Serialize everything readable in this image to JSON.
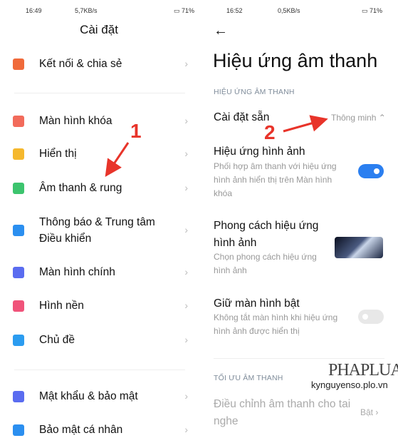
{
  "left": {
    "status": {
      "time": "16:49",
      "speed": "5,7KB/s",
      "battery": "71"
    },
    "title": "Cài đặt",
    "items": [
      {
        "label": "Kết nối & chia sẻ",
        "icon": "connection-icon",
        "color": "#f06a3a"
      },
      {
        "label": "Màn hình khóa",
        "icon": "lock-icon",
        "color": "#f26b5b"
      },
      {
        "label": "Hiển thị",
        "icon": "sun-icon",
        "color": "#f5b82e"
      },
      {
        "label": "Âm thanh & rung",
        "icon": "speaker-icon",
        "color": "#3cc46e"
      },
      {
        "label": "Thông báo & Trung tâm",
        "label2": "Điều khiển",
        "icon": "notification-icon",
        "color": "#2b8ff0"
      },
      {
        "label": "Màn hình chính",
        "icon": "home-icon",
        "color": "#5a6cf0"
      },
      {
        "label": "Hình nền",
        "icon": "flower-icon",
        "color": "#f0537a"
      },
      {
        "label": "Chủ đề",
        "icon": "theme-icon",
        "color": "#2b9cf0"
      },
      {
        "label": "Mật khẩu & bảo mật",
        "icon": "fingerprint-icon",
        "color": "#5a6cf0"
      },
      {
        "label": "Bảo mật cá nhân",
        "icon": "privacy-icon",
        "color": "#2b8ff0"
      }
    ]
  },
  "right": {
    "status": {
      "time": "16:52",
      "speed": "0,5KB/s",
      "battery": "71"
    },
    "title": "Hiệu ứng âm thanh",
    "section1": "HIỆU ỨNG ÂM THANH",
    "preset": {
      "label": "Cài đặt sẵn",
      "value": "Thông minh"
    },
    "visual": {
      "label": "Hiệu ứng hình ảnh",
      "desc1": "Phối hợp âm thanh với hiệu ứng",
      "desc2": "hình ảnh hiển thị trên Màn hình",
      "desc3": "khóa",
      "enabled": true
    },
    "style": {
      "label1": "Phong cách hiệu ứng",
      "label2": "hình ảnh",
      "desc1": "Chọn phong cách hiệu ứng",
      "desc2": "hình ảnh"
    },
    "keep": {
      "label": "Giữ màn hình bật",
      "desc1": "Không tắt màn hình khi hiệu ứng",
      "desc2": "hình ảnh được hiển thị",
      "enabled": false
    },
    "section2": "TỐI ƯU ÂM THANH",
    "headphone": {
      "label1": "Điều chỉnh âm thanh cho tai",
      "label2": "nghe",
      "value": "Bật"
    }
  },
  "annotations": {
    "one": "1",
    "two": "2"
  },
  "watermark": {
    "brand": "PHAPLUAT",
    "site": "kynguyenso.plo.vn"
  },
  "colors": {
    "accent": "#2b7ff0",
    "annotation": "#e8342a"
  }
}
